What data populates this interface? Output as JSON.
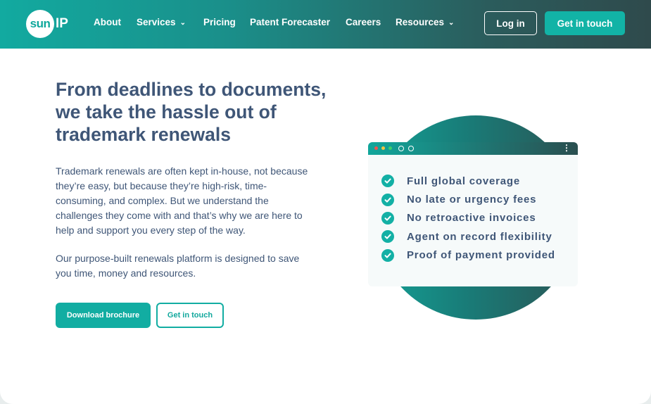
{
  "nav": {
    "logo_text": "sun",
    "logo_suffix": "IP",
    "items": [
      {
        "label": "About"
      },
      {
        "label": "Services"
      },
      {
        "label": "Pricing"
      },
      {
        "label": "Patent Forecaster"
      },
      {
        "label": "Careers"
      },
      {
        "label": "Resources"
      }
    ],
    "login": "Log in",
    "contact": "Get in touch"
  },
  "hero": {
    "headline": "From deadlines to documents, we take the hassle out of trademark renewals",
    "paragraph1": "Trademark renewals are often kept in-house, not because they’re easy, but because they’re high-risk, time-consuming, and complex. But we understand the challenges they come with and that’s why we are here to help and support you every step of the way.",
    "paragraph2": "Our purpose-built renewals platform is designed to save you time, money and resources.",
    "download_button": "Download brochure",
    "touch_button": "Get in touch"
  },
  "features": {
    "items": [
      {
        "label": "Full global coverage"
      },
      {
        "label": "No late or urgency fees"
      },
      {
        "label": "No retroactive invoices"
      },
      {
        "label": "Agent on record flexibility"
      },
      {
        "label": "Proof of payment provided"
      }
    ]
  },
  "colors": {
    "brand_teal": "#12ada2",
    "heading_navy": "#3f5677",
    "nav_dark": "#2f4a4c",
    "dot_red": "#f0544f",
    "dot_yellow": "#f5c542",
    "dot_green": "#3fcf6a"
  },
  "icons": {
    "chevron": "chevron-down-icon",
    "check": "check-circle-icon",
    "menu": "kebab-menu-icon"
  }
}
